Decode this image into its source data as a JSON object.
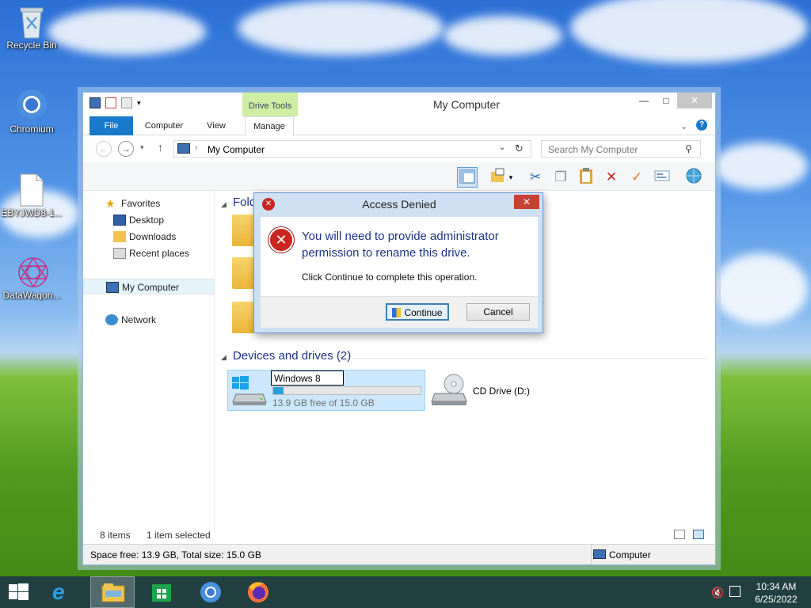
{
  "desktop": {
    "icons": [
      {
        "label": "Recycle Bin"
      },
      {
        "label": "Chromium"
      },
      {
        "label": "EBYJWD8-1..."
      },
      {
        "label": "DataWagon..."
      }
    ]
  },
  "window": {
    "title": "My Computer",
    "contextual_tab": "Drive Tools",
    "tabs": {
      "file": "File",
      "computer": "Computer",
      "view": "View",
      "manage": "Manage"
    },
    "address": "My Computer",
    "search_placeholder": "Search My Computer",
    "nav": {
      "favorites": "Favorites",
      "desktop": "Desktop",
      "downloads": "Downloads",
      "recent": "Recent places",
      "mycomputer": "My Computer",
      "network": "Network"
    },
    "groups": {
      "folders": "Fold",
      "devices": "Devices and drives (2)"
    },
    "drive_c": {
      "rename_value": "Windows 8",
      "free_text": "13.9 GB free of 15.0 GB",
      "used_fraction": 0.07
    },
    "drive_d": {
      "label": "CD Drive (D:)"
    },
    "status": {
      "items": "8 items",
      "selected": "1 item selected"
    },
    "details": {
      "space": "Space free: 13.9 GB, Total size: 15.0 GB",
      "location": "Computer"
    }
  },
  "dialog": {
    "title": "Access Denied",
    "message": "You will need to provide administrator permission to rename this drive.",
    "sub": "Click Continue to complete this operation.",
    "continue": "Continue",
    "cancel": "Cancel"
  },
  "taskbar": {
    "time": "10:34 AM",
    "date": "6/25/2022"
  },
  "colors": {
    "accent": "#1979ca",
    "selection": "#cce8ff",
    "progress": "#26a0da",
    "error": "#c84031"
  }
}
